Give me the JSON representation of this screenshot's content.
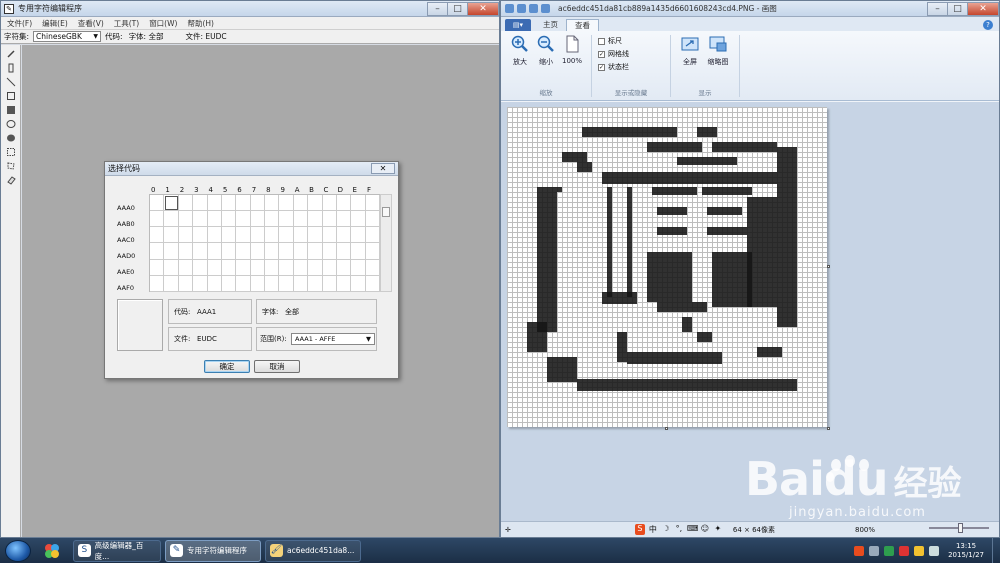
{
  "eudc": {
    "title": "专用字符编辑程序",
    "menu": [
      "文件(F)",
      "编辑(E)",
      "查看(V)",
      "工具(T)",
      "窗口(W)",
      "帮助(H)"
    ],
    "charset_label": "字符集:",
    "charset_value": "ChineseGBK",
    "code_label": "代码:",
    "font_info": "字体: 全部",
    "file_info": "文件: EUDC"
  },
  "dialog": {
    "title": "选择代码",
    "columns": [
      "0",
      "1",
      "2",
      "3",
      "4",
      "5",
      "6",
      "7",
      "8",
      "9",
      "A",
      "B",
      "C",
      "D",
      "E",
      "F"
    ],
    "rows": [
      "AAA0",
      "AAB0",
      "AAC0",
      "AAD0",
      "AAE0",
      "AAF0"
    ],
    "code_label": "代码:",
    "code_value": "AAA1",
    "font_label": "字体:",
    "font_value": "全部",
    "file_label": "文件:",
    "file_value": "EUDC",
    "range_label": "范围(R):",
    "range_value": "AAA1 - AFFE",
    "ok": "确定",
    "cancel": "取消"
  },
  "paint": {
    "title": "ac6eddc451da81cb889a1435d6601608243cd4.PNG - 画图",
    "app_menu": "▤▾",
    "tabs": [
      "主页",
      "查看"
    ],
    "zoom_in": "放大",
    "zoom_out": "缩小",
    "zoom_100": "100%",
    "zoom_group": "缩放",
    "ruler": "标尺",
    "gridlines": "网格线",
    "statusbar_toggle": "状态栏",
    "show_group": "显示或隐藏",
    "fullscreen": "全屏",
    "thumbnail": "缩略图",
    "display_group": "显示",
    "status_size": "64 × 64像素",
    "zoom_level": "800%"
  },
  "watermark": {
    "brand": "Bai",
    "brand2": "du",
    "jingyan": "经验",
    "url": "jingyan.baidu.com"
  },
  "taskbar": {
    "items": [
      "高级编辑器_百度...",
      "专用字符编辑程序",
      "ac6eddc451da8..."
    ],
    "time": "13:15",
    "date": "2015/1/27"
  }
}
